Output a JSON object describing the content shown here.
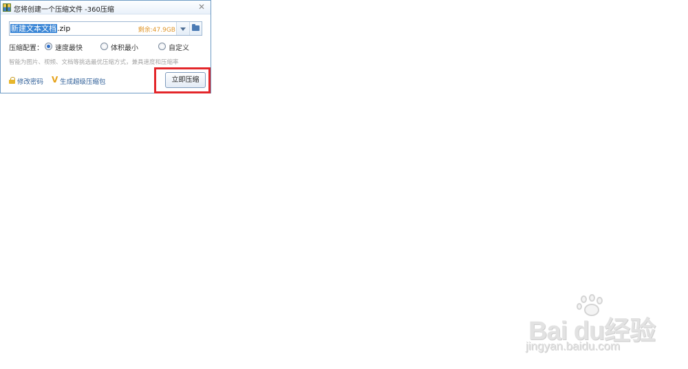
{
  "window": {
    "title": "您将创建一个压缩文件 -360压缩",
    "close_glyph": "✕"
  },
  "filename": {
    "selected_part": "新建文本文档",
    "extension": ".zip"
  },
  "free_space": "剩余:47.9GB",
  "config": {
    "label": "压缩配置：",
    "options": [
      {
        "label": "速度最快",
        "checked": true
      },
      {
        "label": "体积最小",
        "checked": false
      },
      {
        "label": "自定义",
        "checked": false
      }
    ]
  },
  "hint": "智能为图片、视频、文档等挑选最优压缩方式，兼具速度和压缩率",
  "links": {
    "change_password": "修改密码",
    "super_package": "生成超级压缩包"
  },
  "compress_button": "立即压缩",
  "colors": {
    "highlight_border": "#e3262a",
    "free_space_text": "#e0962a",
    "link_text": "#2f5f98",
    "selection_bg": "#3a86d6"
  },
  "watermark": {
    "brand": "Bai du",
    "brand_suffix": "经验",
    "url": "jingyan.baidu.com"
  }
}
